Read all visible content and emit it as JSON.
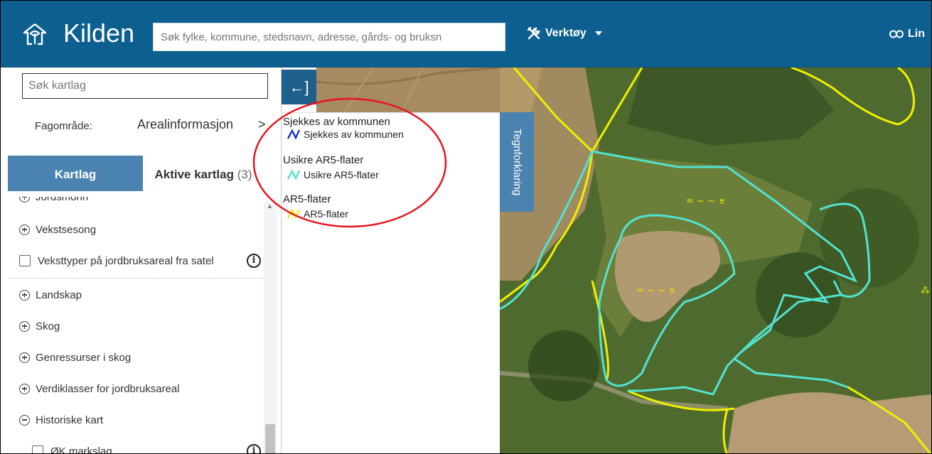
{
  "app": {
    "title": "Kilden"
  },
  "header": {
    "search_placeholder": "Søk fylke, kommune, stedsnavn, adresse, gårds- og bruksn",
    "tools_label": "Verktøy",
    "link_label": "Lin"
  },
  "sidebar": {
    "search_placeholder": "Søk kartlag",
    "fagomrade_label": "Fagområde:",
    "fagomrade_value": "Arealinformasjon",
    "tabs": {
      "kartlag": "Kartlag",
      "aktive": "Aktive kartlag",
      "aktive_count": "(3)"
    },
    "items": [
      {
        "label": "Jordsmonn",
        "kind": "expand"
      },
      {
        "label": "Vekstsesong",
        "kind": "expand"
      },
      {
        "label": "Veksttyper på jordbruksareal fra satel",
        "kind": "checkbox",
        "info": true
      },
      {
        "label": "Landskap",
        "kind": "expand"
      },
      {
        "label": "Skog",
        "kind": "expand"
      },
      {
        "label": "Genressurser i skog",
        "kind": "expand"
      },
      {
        "label": "Verdiklasser for jordbruksareal",
        "kind": "expand"
      },
      {
        "label": "Historiske kart",
        "kind": "collapse"
      },
      {
        "label": "ØK markslag",
        "kind": "checkbox",
        "info": true
      }
    ]
  },
  "legend": {
    "toggle_icon": "←]",
    "tab_label": "Tegnforklaring",
    "groups": [
      {
        "title": "Sjekkes av kommunen",
        "item": "Sjekkes av kommunen",
        "color": "#1a2fd6"
      },
      {
        "title": "Usikre AR5-flater",
        "item": "Usikre AR5-flater",
        "color": "#52e3d0"
      },
      {
        "title": "AR5-flater",
        "item": "AR5-flater",
        "color": "#f0f000"
      }
    ]
  },
  "map": {
    "symbol_text_1": "= ~ ~ ⌆",
    "symbol_text_2": "= ~ ~ ⌆"
  },
  "colors": {
    "header": "#0d5f8f",
    "tab_active": "#4a82b0",
    "annotation": "#e8141d"
  }
}
